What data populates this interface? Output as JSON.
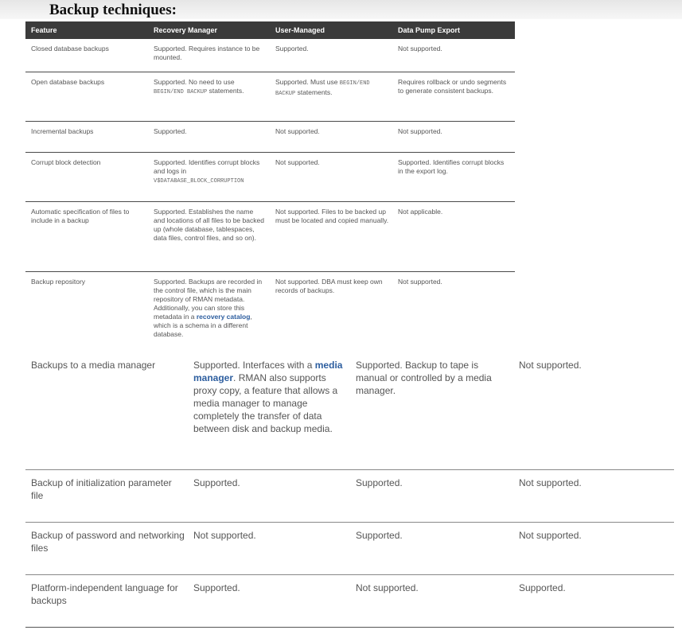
{
  "title": "Backup techniques:",
  "headers": [
    "Feature",
    "Recovery Manager",
    "User-Managed",
    "Data Pump Export"
  ],
  "small_rows": [
    {
      "feature": "Closed database backups",
      "rman": "Supported. Requires instance to be mounted.",
      "user": "Supported.",
      "pump": "Not supported."
    },
    {
      "feature": "Open database backups",
      "rman_pre": "Supported. No need to use ",
      "rman_code": "BEGIN/END BACKUP",
      "rman_post": " statements.",
      "user_pre": "Supported. Must use ",
      "user_code": "BEGIN/END BACKUP",
      "user_post": " statements.",
      "pump": "Requires rollback or undo segments to generate consistent backups."
    },
    {
      "feature": "Incremental backups",
      "rman": "Supported.",
      "user": "Not supported.",
      "pump": "Not supported."
    },
    {
      "feature": "Corrupt block detection",
      "rman_pre": "Supported. Identifies corrupt blocks and logs in ",
      "rman_code": "V$DATABASE_BLOCK_CORRUPTION",
      "user": "Not supported.",
      "pump": "Supported. Identifies corrupt blocks in the export log."
    },
    {
      "feature": "Automatic specification of files to include in a backup",
      "rman": "Supported. Establishes the name and locations of all files to be backed up (whole database, tablespaces, data files, control files, and so on).",
      "user": "Not supported. Files to be backed up must be located and copied manually.",
      "pump": "Not applicable."
    },
    {
      "feature": "Backup repository",
      "rman_pre": "Supported. Backups are recorded in the control file, which is the main repository of RMAN metadata. Additionally, you can store this metadata in a ",
      "rman_link": "recovery catalog",
      "rman_post": ", which is a schema in a different database.",
      "user": "Not supported. DBA must keep own records of backups.",
      "pump": "Not supported."
    }
  ],
  "big_rows": [
    {
      "feature": "Backups to a media manager",
      "rman_pre": "Supported. Interfaces with a ",
      "rman_link": "media manager",
      "rman_post": ". RMAN also supports proxy copy, a feature that allows a media manager to manage completely the transfer of data between disk and backup media.",
      "user": "Supported. Backup to tape is manual or controlled by a media manager.",
      "pump": "Not supported."
    },
    {
      "feature": "Backup of initialization parameter file",
      "rman": "Supported.",
      "user": "Supported.",
      "pump": "Not supported."
    },
    {
      "feature": "Backup of password and networking files",
      "rman": "Not supported.",
      "user": "Supported.",
      "pump": "Not supported."
    },
    {
      "feature": "Platform-independent language for backups",
      "rman": "Supported.",
      "user": "Not supported.",
      "pump": "Supported."
    }
  ],
  "colors": {
    "header_bg": "#3b3b3b",
    "link": "#2d5e9f"
  }
}
